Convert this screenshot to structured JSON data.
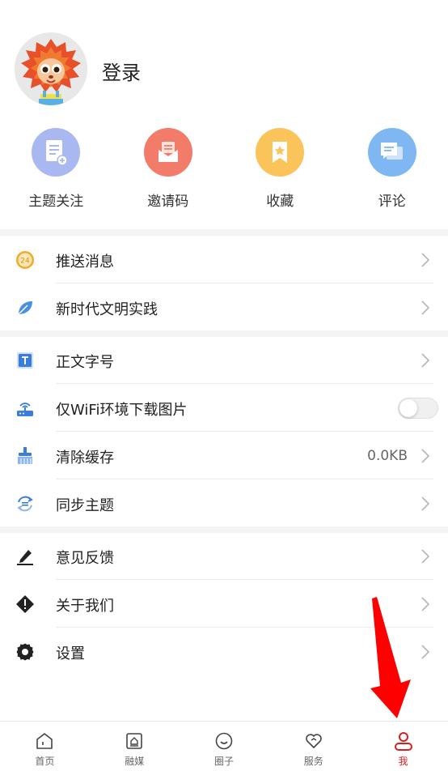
{
  "profile": {
    "login_label": "登录"
  },
  "quick_actions": [
    {
      "label": "主题关注",
      "icon": "topic-follow-icon",
      "color": "#aab8f2"
    },
    {
      "label": "邀请码",
      "icon": "invite-code-icon",
      "color": "#f37b6a"
    },
    {
      "label": "收藏",
      "icon": "favorite-icon",
      "color": "#fbc45b"
    },
    {
      "label": "评论",
      "icon": "comment-icon",
      "color": "#7fb7f2"
    }
  ],
  "menu": {
    "push": {
      "label": "推送消息",
      "icon": "push-24-icon",
      "badge": "24"
    },
    "civilization": {
      "label": "新时代文明实践",
      "icon": "leaf-icon"
    },
    "font_size": {
      "label": "正文字号",
      "icon": "text-size-icon"
    },
    "wifi_images": {
      "label": "仅WiFi环境下载图片",
      "icon": "wifi-router-icon",
      "enabled": false
    },
    "clear_cache": {
      "label": "清除缓存",
      "icon": "broom-icon",
      "value": "0.0KB"
    },
    "sync_theme": {
      "label": "同步主题",
      "icon": "sync-icon"
    },
    "feedback": {
      "label": "意见反馈",
      "icon": "pencil-icon"
    },
    "about": {
      "label": "关于我们",
      "icon": "info-diamond-icon"
    },
    "settings": {
      "label": "设置",
      "icon": "gear-icon"
    }
  },
  "tabs": [
    {
      "label": "首页",
      "icon": "home-icon",
      "active": false
    },
    {
      "label": "融媒",
      "icon": "media-icon",
      "active": false
    },
    {
      "label": "圈子",
      "icon": "circle-smile-icon",
      "active": false
    },
    {
      "label": "服务",
      "icon": "heart-service-icon",
      "active": false
    },
    {
      "label": "我",
      "icon": "user-icon",
      "active": true
    }
  ],
  "colors": {
    "accent": "#d81e1e",
    "annotation_arrow": "#ff0000"
  }
}
